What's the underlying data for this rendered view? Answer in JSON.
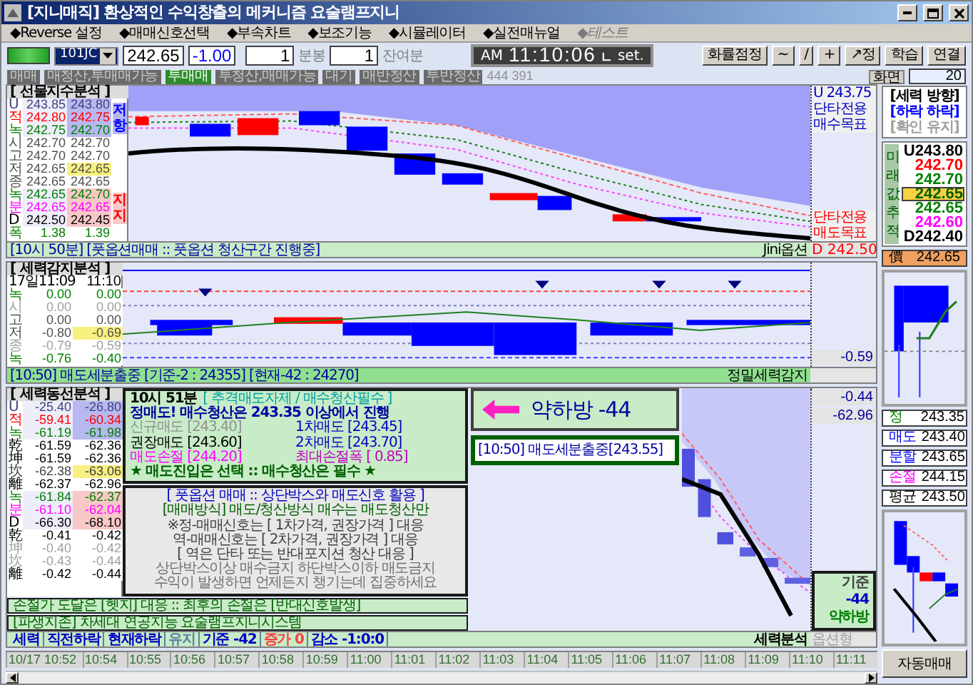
{
  "window": {
    "title": "[지니매직] 환상적인 수익창출의 메커니즘 요술램프지니"
  },
  "menu": [
    {
      "label": "◆Reverse 설정",
      "disabled": false
    },
    {
      "label": "◆매매신호선택",
      "disabled": false
    },
    {
      "label": "◆부속차트",
      "disabled": false
    },
    {
      "label": "◆보조기능",
      "disabled": false
    },
    {
      "label": "◆시뮬레이터",
      "disabled": false
    },
    {
      "label": "◆실전매뉴얼",
      "disabled": false
    },
    {
      "label": "◆테스트",
      "disabled": true
    }
  ],
  "toolbar": {
    "symbol": "101JC",
    "price": "242.65",
    "change": "-1.00",
    "bar_count": "1",
    "bar_unit": "분봉",
    "remaining_count": "1",
    "remaining_unit": "잔여분",
    "clock": {
      "meridiem": "AM",
      "time": "11:10:06",
      "set_label": "set."
    },
    "buttons": [
      "화률점정",
      "~",
      "/",
      "+",
      "↗정",
      "학습",
      "연결"
    ]
  },
  "signal_chips": [
    {
      "label": "매매",
      "active": false
    },
    {
      "label": "매청산,투매매가능",
      "active": false
    },
    {
      "label": "투매매",
      "active": true
    },
    {
      "label": "투청산,매매가능",
      "active": false
    },
    {
      "label": "대기",
      "active": false
    },
    {
      "label": "매반청산",
      "active": false
    },
    {
      "label": "투반청산",
      "active": false
    }
  ],
  "counter": "444 391",
  "screen": {
    "label": "화면",
    "value": "20"
  },
  "futures_panel": {
    "title": "[ 선물지수분석 ]",
    "resistance_label": "저항",
    "support_label": "지지",
    "rows": [
      {
        "label": "U",
        "previous": "243.85",
        "current": "243.80",
        "color": "#404080",
        "resistance_zone": true,
        "support_zone": false,
        "highlighted": false
      },
      {
        "label": "적",
        "previous": "242.80",
        "current": "242.75",
        "color": "#ff0000",
        "resistance_zone": true,
        "support_zone": false,
        "highlighted": false
      },
      {
        "label": "녹",
        "previous": "242.75",
        "current": "242.70",
        "color": "#008000",
        "resistance_zone": true,
        "support_zone": false,
        "highlighted": false
      },
      {
        "label": "시",
        "previous": "242.70",
        "current": "242.70",
        "color": "#505050",
        "resistance_zone": false,
        "support_zone": false,
        "highlighted": false
      },
      {
        "label": "고",
        "previous": "242.70",
        "current": "242.70",
        "color": "#505050",
        "resistance_zone": false,
        "support_zone": false,
        "highlighted": false
      },
      {
        "label": "저",
        "previous": "242.65",
        "current": "242.65",
        "color": "#505050",
        "resistance_zone": false,
        "support_zone": false,
        "highlighted": true
      },
      {
        "label": "종",
        "previous": "242.65",
        "current": "242.65",
        "color": "#505050",
        "resistance_zone": false,
        "support_zone": false,
        "highlighted": false
      },
      {
        "label": "녹",
        "previous": "242.65",
        "current": "242.70",
        "color": "#008000",
        "resistance_zone": false,
        "support_zone": true,
        "highlighted": false
      },
      {
        "label": "분",
        "previous": "242.65",
        "current": "242.65",
        "color": "#ff00ff",
        "resistance_zone": false,
        "support_zone": true,
        "highlighted": false
      },
      {
        "label": "D",
        "previous": "242.50",
        "current": "242.45",
        "color": "#000000",
        "resistance_zone": false,
        "support_zone": true,
        "highlighted": false
      },
      {
        "label": "폭",
        "previous": "1.38",
        "current": "1.39",
        "color": "#008000",
        "resistance_zone": false,
        "support_zone": false,
        "highlighted": false
      }
    ],
    "upper_labels": [
      "U 243.75",
      "단타전용",
      "매수목표"
    ],
    "lower_labels": [
      "단타전용",
      "매도목표"
    ],
    "status": "[10시 50분] [풋옵션매매 :: 풋옵션 청산구간 진행중]",
    "status_source": "Jini옵션",
    "status_value": "D 242.50"
  },
  "force_panel": {
    "title": "[ 세력감지분석 ]",
    "header_time": "17일11:09",
    "header_current": "11:10",
    "rows": [
      {
        "label": "녹",
        "previous": "0.00",
        "current": "0.00",
        "color": "#008000",
        "highlighted": false
      },
      {
        "label": "시",
        "previous": "0.00",
        "current": "0.00",
        "color": "#a0a0a0",
        "highlighted": false
      },
      {
        "label": "고",
        "previous": "0.00",
        "current": "0.00",
        "color": "#505050",
        "highlighted": false
      },
      {
        "label": "저",
        "previous": "-0.80",
        "current": "-0.69",
        "color": "#505050",
        "highlighted": true
      },
      {
        "label": "종",
        "previous": "-0.79",
        "current": "-0.59",
        "color": "#a0a0a0",
        "highlighted": false
      },
      {
        "label": "녹",
        "previous": "-0.76",
        "current": "-0.40",
        "color": "#008000",
        "highlighted": false
      }
    ],
    "status": "[10:50] 매도세분출중 [기준-2 : 24355] [현재-42 : 24270]",
    "status_right": "정밀세력감지",
    "reading": "-0.59"
  },
  "flow_panel": {
    "title": "[ 세력동선분석 ]",
    "rows": [
      {
        "label": "U",
        "previous": "-25.40",
        "current": "-26.80",
        "color": "#404080",
        "resistance_zone": true,
        "support_zone": false,
        "highlighted": false
      },
      {
        "label": "적",
        "previous": "-59.41",
        "current": "-60.34",
        "color": "#ff0000",
        "resistance_zone": true,
        "support_zone": false,
        "highlighted": false
      },
      {
        "label": "녹",
        "previous": "-61.19",
        "current": "-61.98",
        "color": "#008000",
        "resistance_zone": true,
        "support_zone": false,
        "highlighted": false
      },
      {
        "label": "乾",
        "previous": "-61.59",
        "current": "-62.36",
        "color": "#000000",
        "resistance_zone": false,
        "support_zone": false,
        "highlighted": false
      },
      {
        "label": "坤",
        "previous": "-61.59",
        "current": "-62.36",
        "color": "#000000",
        "resistance_zone": false,
        "support_zone": false,
        "highlighted": false
      },
      {
        "label": "坎",
        "previous": "-62.38",
        "current": "-63.06",
        "color": "#404040",
        "resistance_zone": false,
        "support_zone": false,
        "highlighted": true
      },
      {
        "label": "離",
        "previous": "-62.37",
        "current": "-62.96",
        "color": "#000000",
        "resistance_zone": false,
        "support_zone": false,
        "highlighted": false
      },
      {
        "label": "녹",
        "previous": "-61.84",
        "current": "-62.37",
        "color": "#008000",
        "resistance_zone": false,
        "support_zone": true,
        "highlighted": false
      },
      {
        "label": "분",
        "previous": "-61.10",
        "current": "-62.04",
        "color": "#ff00ff",
        "resistance_zone": false,
        "support_zone": true,
        "highlighted": false
      },
      {
        "label": "D",
        "previous": "-66.30",
        "current": "-68.10",
        "color": "#000000",
        "resistance_zone": false,
        "support_zone": true,
        "highlighted": false
      },
      {
        "label": "乾",
        "previous": "-0.41",
        "current": "-0.42",
        "color": "#000000",
        "resistance_zone": false,
        "support_zone": false,
        "highlighted": false
      },
      {
        "label": "坤",
        "previous": "-0.40",
        "current": "-0.42",
        "color": "#a0a0a0",
        "resistance_zone": false,
        "support_zone": false,
        "highlighted": false
      },
      {
        "label": "坎",
        "previous": "-0.43",
        "current": "-0.44",
        "color": "#a0a0a0",
        "resistance_zone": false,
        "support_zone": false,
        "highlighted": false
      },
      {
        "label": "離",
        "previous": "-0.42",
        "current": "-0.44",
        "color": "#000000",
        "resistance_zone": false,
        "support_zone": false,
        "highlighted": false
      }
    ],
    "advice_box": {
      "time": "10시 51분",
      "headline": "[ 추격매도자제 / 매수청산필수 ]",
      "summary": "정매도! 매수청산은 243.35 이상에서 진행",
      "prices": [
        {
          "text": "신규매도 [243.40]",
          "color": "#909090"
        },
        {
          "text": "1차매도 [243.45]",
          "color": "#0000c0"
        },
        {
          "text": "권장매도 [243.60]",
          "color": "#000000"
        },
        {
          "text": "2차매도 [243.70]",
          "color": "#0000c0"
        },
        {
          "text": "매도손절 [244.20]",
          "color": "#ff00ff"
        },
        {
          "text": "최대손절폭 [ 0.85]",
          "color": "#c000c0"
        }
      ],
      "footer": "★ 매도진입은 선택 :: 매수청산은 필수 ★"
    },
    "guide_box": [
      {
        "text": "[ 풋옵션 매매 :: 상단박스와 매도신호 활용 ]",
        "color": "#0000c0"
      },
      {
        "text": "[매매방식] 매도/청산방식 매수는 매도청산만",
        "color": "#006000"
      },
      {
        "text": "※정-매매신호는 [ 1차가격, 권장가격 ] 대응",
        "color": "#404040"
      },
      {
        "text": "역-매매신호는 [ 2차가격, 권장가격 ] 대응",
        "color": "#404040"
      },
      {
        "text": "[ 역은 단타 또는 반대포지션 청산 대응 ]",
        "color": "#404040"
      },
      {
        "text": "상단박스이상 매수금지 하단박스이하 매도금지",
        "color": "#707070"
      },
      {
        "text": "수익이 발생하면 언제든지 챙기는데 집중하세요",
        "color": "#707070"
      }
    ],
    "notices": [
      "손절가 도달은 [헷지] 대응 :: 최후의 손절은 [반대신호발생]",
      "[파생지존] 차세대 연공지능 요술램프지니시스템"
    ],
    "direction": "약하방 -44",
    "signal_box": "[10:50] 매도세분출중[243.55]",
    "readings": [
      "-0.44",
      "-62.96"
    ],
    "summary_box": [
      "기준",
      "-44",
      "약하방"
    ],
    "status_segments": [
      {
        "text": "세력",
        "color": "#0000c0"
      },
      {
        "text": "직전하락",
        "color": "#0000c0"
      },
      {
        "text": "현재하락",
        "color": "#0000c0"
      },
      {
        "text": "유지",
        "color": "#6080a0"
      },
      {
        "text": "기준 -42",
        "color": "#0000c0"
      },
      {
        "text": "증가 0",
        "color": "#ff4040"
      },
      {
        "text": "감소 -1:0:0",
        "color": "#0000c0"
      }
    ],
    "status_right": "세력분석",
    "status_faded": "옵션형"
  },
  "side_panel": {
    "direction_title": "[세력 방향]",
    "direction_lines": [
      {
        "text": "[하락 하락]",
        "color": "#0000ff"
      },
      {
        "text": "[확인 유지]",
        "color": "#a0a0a0"
      }
    ],
    "forecast_label": "미래값추적",
    "forecast": [
      {
        "text": "U243.80",
        "color": "#000000",
        "highlighted": false
      },
      {
        "text": "242.70",
        "color": "#ff0000",
        "highlighted": false
      },
      {
        "text": "242.70",
        "color": "#008000",
        "highlighted": false
      },
      {
        "text": "242.65",
        "highlighted": true
      },
      {
        "text": "242.65",
        "color": "#008000",
        "highlighted": false
      },
      {
        "text": "242.60",
        "color": "#ff00ff",
        "highlighted": false
      },
      {
        "text": "D242.40",
        "color": "#000000",
        "highlighted": false
      }
    ],
    "price_label": "價",
    "price_value": "242.65",
    "orders": [
      {
        "label": "정",
        "value": "243.35",
        "color": "#008000"
      },
      {
        "label": "매도",
        "value": "243.40",
        "color": "#0000ff"
      },
      {
        "label": "분할",
        "value": "243.65",
        "color": "#0000ff"
      },
      {
        "label": "손절",
        "value": "244.15",
        "color": "#ff00ff"
      },
      {
        "label": "평균",
        "value": "243.50",
        "color": "#000000"
      }
    ],
    "auto_trade_button": "자동매매"
  },
  "time_axis": [
    "10/17 10:52",
    "10:54",
    "10:55",
    "10:56",
    "10:57",
    "10:58",
    "10:59",
    "11:00",
    "11:01",
    "11:02",
    "11:03",
    "11:04",
    "11:05",
    "11:06",
    "11:07",
    "11:08",
    "11:09",
    "11:10",
    "11:11"
  ]
}
